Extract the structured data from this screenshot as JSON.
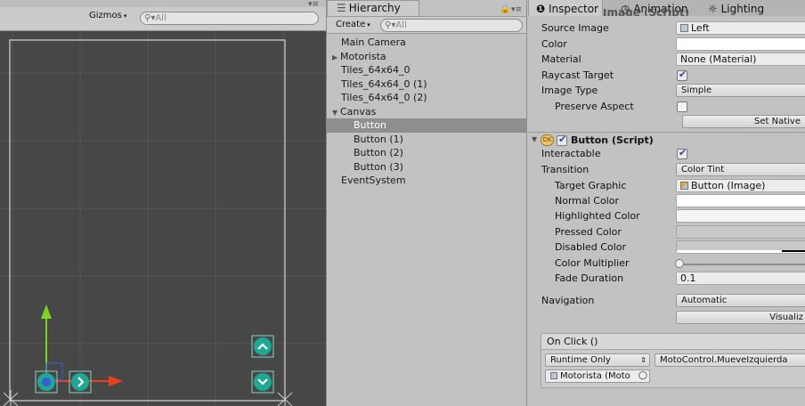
{
  "scene": {
    "menu_glyph": "▾≡",
    "gizmos_label": "Gizmos",
    "dropdown_glyph": "▾",
    "search_placeholder": "All"
  },
  "hierarchy": {
    "tab_label": "Hierarchy",
    "create_label": "Create",
    "search_placeholder": "All",
    "items": [
      {
        "label": "Main Camera"
      },
      {
        "label": "Motorista"
      },
      {
        "label": "Tiles_64x64_0"
      },
      {
        "label": "Tiles_64x64_0 (1)"
      },
      {
        "label": "Tiles_64x64_0 (2)"
      },
      {
        "label": "Canvas"
      },
      {
        "label": "Button"
      },
      {
        "label": "Button (1)"
      },
      {
        "label": "Button (2)"
      },
      {
        "label": "Button (3)"
      },
      {
        "label": "EventSystem"
      }
    ]
  },
  "inspector": {
    "tabs": {
      "inspector": "Inspector",
      "animation": "Animation",
      "lighting": "Lighting"
    },
    "image_component_title": "Image (Script)",
    "image": {
      "source_image_label": "Source Image",
      "source_image_value": "Left",
      "color_label": "Color",
      "material_label": "Material",
      "material_value": "None (Material)",
      "raycast_label": "Raycast Target",
      "raycast_checked": true,
      "image_type_label": "Image Type",
      "image_type_value": "Simple",
      "preserve_label": "Preserve Aspect",
      "preserve_checked": false,
      "set_native_label": "Set Native"
    },
    "button_component": {
      "title": "Button (Script)",
      "enabled": true,
      "interactable_label": "Interactable",
      "interactable_checked": true,
      "transition_label": "Transition",
      "transition_value": "Color Tint",
      "target_graphic_label": "Target Graphic",
      "target_graphic_value": "Button (Image)",
      "normal_color_label": "Normal Color",
      "highlighted_color_label": "Highlighted Color",
      "pressed_color_label": "Pressed Color",
      "disabled_color_label": "Disabled Color",
      "color_multiplier_label": "Color Multiplier",
      "color_multiplier_value": 1,
      "fade_duration_label": "Fade Duration",
      "fade_duration_value": "0.1",
      "navigation_label": "Navigation",
      "navigation_value": "Automatic",
      "visualize_label": "Visualiz"
    },
    "on_click": {
      "title": "On Click ()",
      "runtime_value": "Runtime Only",
      "function_value": "MotoControl.MueveIzquierda",
      "object_value": "Motorista (Moto"
    }
  },
  "colors": {
    "scene_bg": "#474747",
    "panel_bg": "#c2c2c2",
    "selection": "#8f8f8f",
    "gizmo_y": "#7ed321",
    "gizmo_x": "#e8401c",
    "ui_button": "#1fa896",
    "normal_color": "#ffffff",
    "highlighted_color": "#f5f5f5",
    "pressed_color": "#c8c8c8",
    "disabled_color": "#c8c8c8"
  }
}
